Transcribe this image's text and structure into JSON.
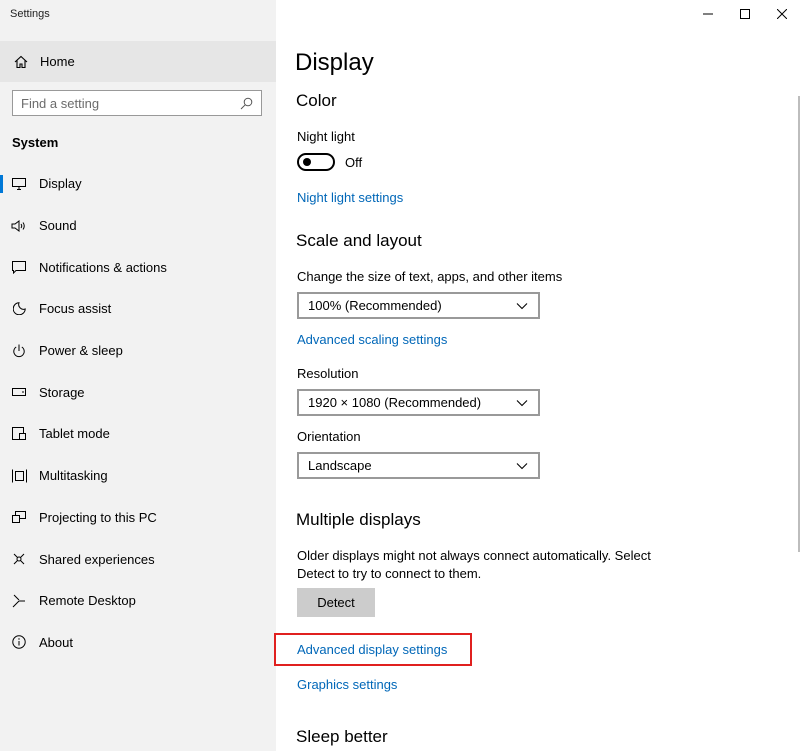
{
  "app": {
    "title": "Settings"
  },
  "sidebar": {
    "home_label": "Home",
    "search_placeholder": "Find a setting",
    "section_heading": "System",
    "items": [
      {
        "label": "Display",
        "icon": "monitor-icon",
        "active": true
      },
      {
        "label": "Sound",
        "icon": "speaker-icon"
      },
      {
        "label": "Notifications & actions",
        "icon": "notification-icon"
      },
      {
        "label": "Focus assist",
        "icon": "moon-icon"
      },
      {
        "label": "Power & sleep",
        "icon": "power-icon"
      },
      {
        "label": "Storage",
        "icon": "storage-icon"
      },
      {
        "label": "Tablet mode",
        "icon": "tablet-icon"
      },
      {
        "label": "Multitasking",
        "icon": "multitasking-icon"
      },
      {
        "label": "Projecting to this PC",
        "icon": "projector-icon"
      },
      {
        "label": "Shared experiences",
        "icon": "share-icon"
      },
      {
        "label": "Remote Desktop",
        "icon": "remote-icon"
      },
      {
        "label": "About",
        "icon": "info-icon"
      }
    ]
  },
  "main": {
    "page_title": "Display",
    "color": {
      "heading": "Color",
      "night_light_label": "Night light",
      "night_light_state": "Off",
      "night_light_link": "Night light settings"
    },
    "scale": {
      "heading": "Scale and layout",
      "size_label": "Change the size of text, apps, and other items",
      "size_value": "100% (Recommended)",
      "advanced_scaling_link": "Advanced scaling settings",
      "resolution_label": "Resolution",
      "resolution_value": "1920 × 1080 (Recommended)",
      "orientation_label": "Orientation",
      "orientation_value": "Landscape"
    },
    "multiple": {
      "heading": "Multiple displays",
      "description": "Older displays might not always connect automatically. Select Detect to try to connect to them.",
      "detect_label": "Detect",
      "advanced_display_link": "Advanced display settings",
      "graphics_link": "Graphics settings"
    },
    "sleep": {
      "heading": "Sleep better"
    }
  },
  "colors": {
    "accent": "#0078d7",
    "link": "#0067b8",
    "highlight": "#e0201f",
    "sidebar_bg": "#f2f2f2"
  }
}
